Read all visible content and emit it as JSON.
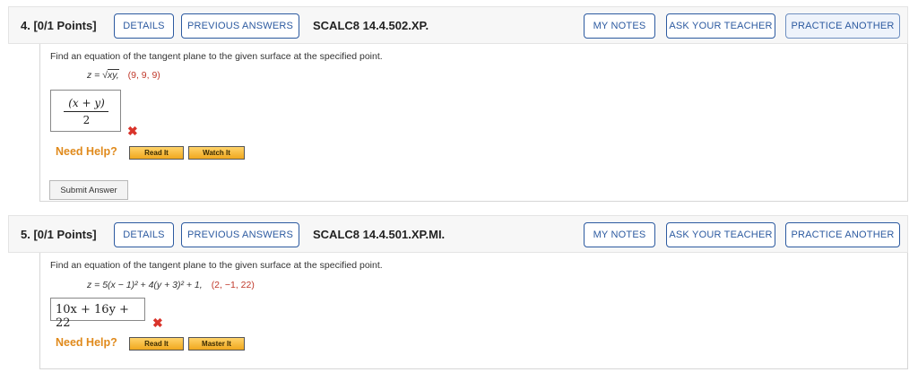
{
  "questions": [
    {
      "number": "4.",
      "points": "[0/1 Points]",
      "details": "DETAILS",
      "previous_answers": "PREVIOUS ANSWERS",
      "code": "SCALC8 14.4.502.XP.",
      "my_notes": "MY NOTES",
      "ask_teacher": "ASK YOUR TEACHER",
      "practice_another": "PRACTICE ANOTHER",
      "prompt": "Find an equation of the tangent plane to the given surface at the specified point.",
      "equation_lhs": "z = ",
      "equation_rhs": "xy,",
      "point": "(9, 9, 9)",
      "answer_numerator": "(x + y)",
      "answer_denominator": "2",
      "need_help": "Need Help?",
      "read_it": "Read It",
      "watch_it": "Watch It",
      "submit": "Submit Answer"
    },
    {
      "number": "5.",
      "points": "[0/1 Points]",
      "details": "DETAILS",
      "previous_answers": "PREVIOUS ANSWERS",
      "code": "SCALC8 14.4.501.XP.MI.",
      "my_notes": "MY NOTES",
      "ask_teacher": "ASK YOUR TEACHER",
      "practice_another": "PRACTICE ANOTHER",
      "prompt": "Find an equation of the tangent plane to the given surface at the specified point.",
      "equation": "z = 5(x − 1)² + 4(y + 3)² + 1,",
      "point": "(2, −1, 22)",
      "answer": "10x + 16y + 22",
      "need_help": "Need Help?",
      "read_it": "Read It",
      "master_it": "Master It"
    }
  ],
  "colors": {
    "accent": "#2c5aa0",
    "error": "#d9342b",
    "help": "#e08a1c",
    "point": "#c0392b"
  },
  "icons": {
    "wrong": "cross-icon"
  }
}
